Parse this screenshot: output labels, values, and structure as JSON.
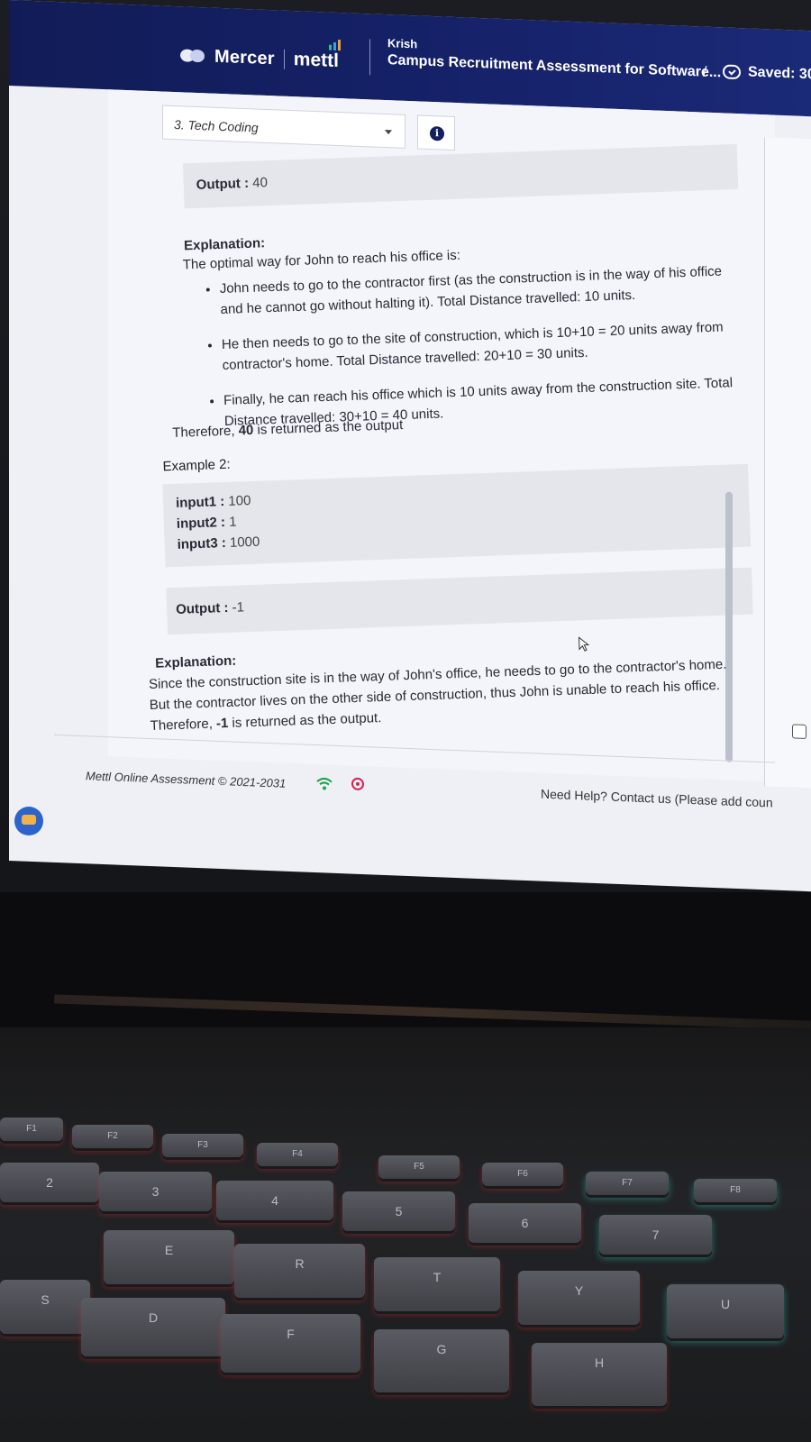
{
  "header": {
    "brand_mercer": "Mercer",
    "brand_mettl": "mettl",
    "user_name": "Krish",
    "assessment_title": "Campus Recruitment Assessment for Software...",
    "separator": "/",
    "saved_status": "Saved: 30"
  },
  "toolbar": {
    "section_selected": "3. Tech Coding",
    "info_glyph": "i"
  },
  "question": {
    "output1_label": "Output :",
    "output1_value": "40",
    "explanation1_title": "Explanation:",
    "explanation1_intro": "The optimal way for John to reach his office is:",
    "bullets": [
      "John needs to go to the contractor first (as the construction is in the way of his office and he cannot go without halting it). Total Distance travelled: 10 units.",
      "He then needs to go to the site of construction, which is 10+10 = 20 units away from contractor's home. Total Distance travelled: 20+10 = 30 units.",
      "Finally, he can reach his office which is 10 units away from the construction site. Total Distance travelled: 30+10 = 40 units."
    ],
    "therefore_prefix": "Therefore,",
    "therefore_value": "40",
    "therefore_suffix": "is returned as the output",
    "example2_title": "Example 2:",
    "inputs": [
      {
        "label": "input1 :",
        "value": "100"
      },
      {
        "label": "input2 :",
        "value": "1"
      },
      {
        "label": "input3 :",
        "value": "1000"
      }
    ],
    "output2_label": "Output :",
    "output2_value": "-1",
    "explanation2_title": "Explanation:",
    "explanation2_text_a": "Since the construction site is in the way of John's office, he needs to go to the contractor's home. But the contractor lives on the other side of construction, thus John is unable to reach his office. Therefore,",
    "explanation2_value": "-1",
    "explanation2_text_b": "is returned as the output."
  },
  "footer": {
    "copyright": "Mettl Online Assessment © 2021-2031",
    "help": "Need Help? Contact us (Please add coun"
  },
  "icons": [
    "mercer-logo-icon",
    "cloud-check-icon",
    "chevron-down-icon",
    "info-icon",
    "wifi-icon",
    "record-icon",
    "chat-icon",
    "cursor-icon"
  ],
  "colors": {
    "header_bg": "#16226a",
    "page_bg": "#eef0f6",
    "code_box_bg": "#e4e6ec",
    "record_red": "#d6244c",
    "keyboard_glow_red": "#ff2828",
    "keyboard_glow_teal": "#28dcc8"
  },
  "keyboard": {
    "fn_keys": [
      "F1",
      "F2",
      "F3",
      "F4",
      "F5",
      "F6",
      "F7",
      "F8"
    ],
    "number_keys": [
      "2",
      "3",
      "4",
      "5",
      "6",
      "7"
    ],
    "letter_keys": [
      "E",
      "R",
      "T",
      "Y",
      "U"
    ],
    "bottom_keys": [
      "S",
      "D",
      "F",
      "G",
      "H"
    ]
  }
}
